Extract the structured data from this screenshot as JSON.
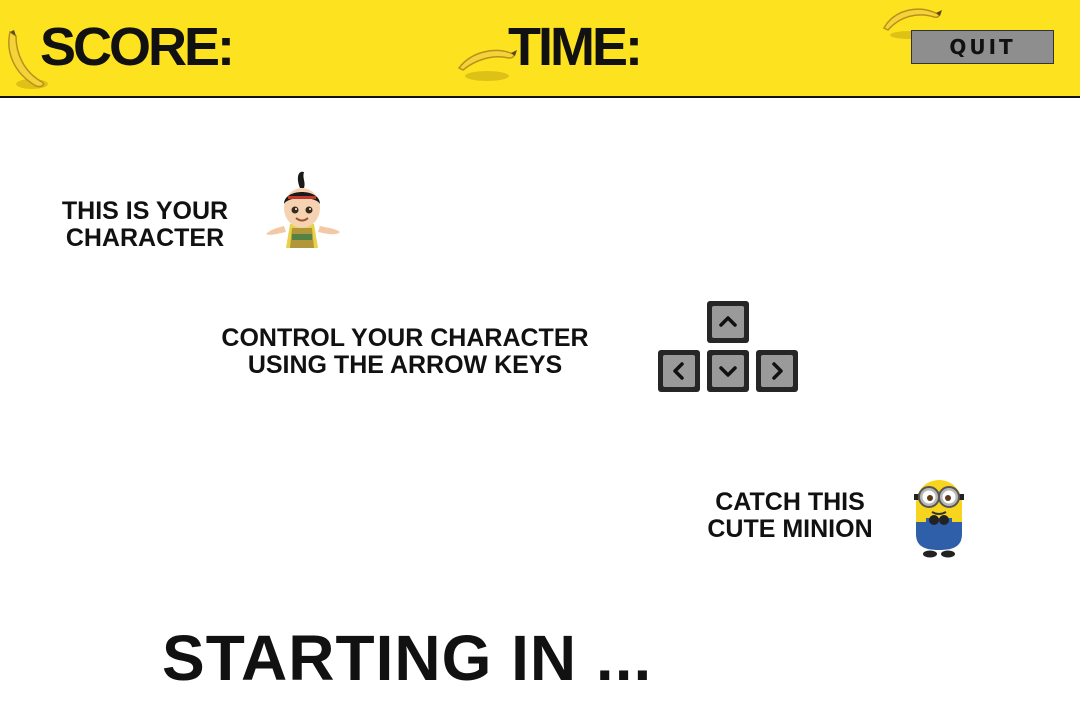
{
  "hud": {
    "score_label": "SCORE:",
    "score_value": "",
    "time_label": "TIME:",
    "time_value": "",
    "quit_label": "QUIT"
  },
  "instructions": {
    "character": [
      "THIS IS YOUR",
      "CHARACTER"
    ],
    "controls": [
      "CONTROL YOUR CHARACTER",
      "USING THE ARROW KEYS"
    ],
    "catch": [
      "CATCH THIS",
      "CUTE MINION"
    ]
  },
  "countdown": {
    "text": "STARTING IN ..."
  },
  "icons": {
    "banana": "banana-icon",
    "player": "girl-character-icon",
    "target": "minion-icon",
    "keys": [
      "arrow-up-key-icon",
      "arrow-left-key-icon",
      "arrow-down-key-icon",
      "arrow-right-key-icon"
    ]
  },
  "colors": {
    "topbar": "#fde21f",
    "quit_button": "#8e8e8e",
    "key_frame": "#262626",
    "key_face": "#9a9a9a"
  }
}
